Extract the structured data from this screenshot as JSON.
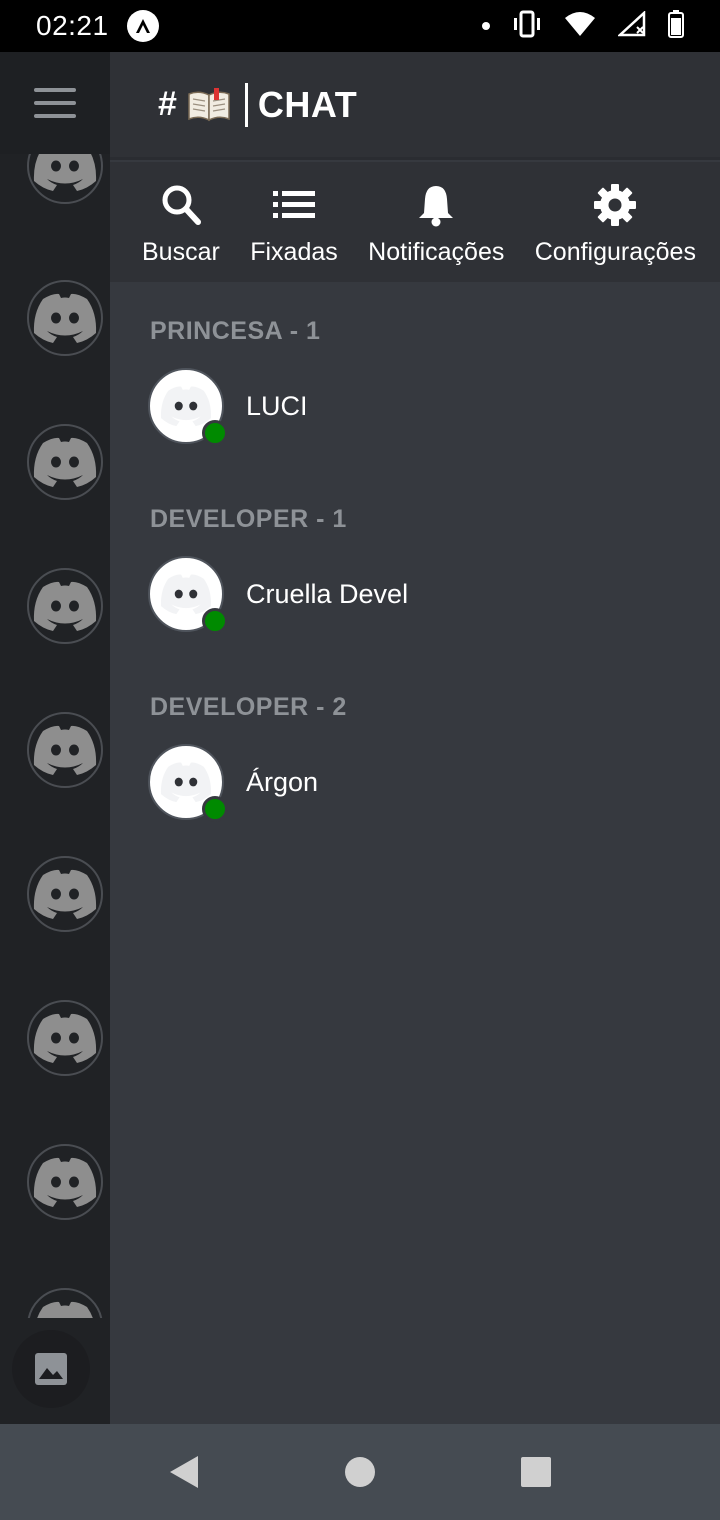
{
  "status_bar": {
    "time": "02:21"
  },
  "channel": {
    "hash": "#",
    "emoji": "open-book-icon",
    "name": "CHAT"
  },
  "toolbar": {
    "search_label": "Buscar",
    "pinned_label": "Fixadas",
    "notifications_label": "Notificações",
    "settings_label": "Configurações"
  },
  "roles": [
    {
      "header": "PRINCESA - 1",
      "members": [
        {
          "name": "LUCI",
          "status": "online"
        }
      ]
    },
    {
      "header": "DEVELOPER - 1",
      "members": [
        {
          "name": "Cruella Devel",
          "status": "online"
        }
      ]
    },
    {
      "header": "DEVELOPER - 2",
      "members": [
        {
          "name": "Árgon",
          "status": "online"
        }
      ]
    }
  ],
  "server_rail": {
    "server_count": 9,
    "icon": "discord-logo-icon"
  },
  "colors": {
    "background": "#36393f",
    "header": "#2f3136",
    "rail": "#202225",
    "online": "#008a00",
    "role_header": "#8e9297"
  }
}
